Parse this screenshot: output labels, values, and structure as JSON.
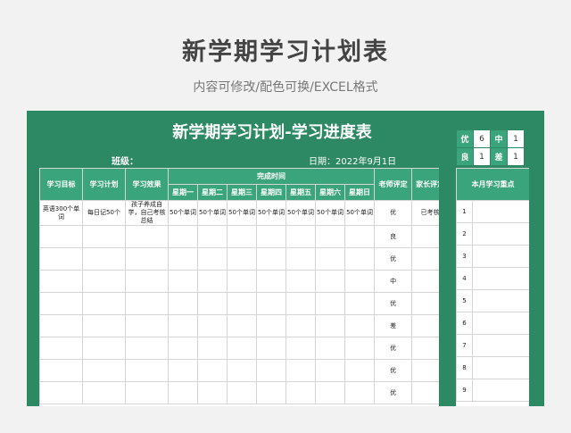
{
  "hero": {
    "title": "新学期学习计划表",
    "subtitle": "内容可修改/配色可换/EXCEL格式"
  },
  "sheet": {
    "title": "新学期学习计划-学习进度表",
    "class_label": "班级：",
    "date_label": "日期：2022年9月1日"
  },
  "grades": [
    {
      "label": "优",
      "value": "6"
    },
    {
      "label": "中",
      "value": "1"
    },
    {
      "label": "良",
      "value": "1"
    },
    {
      "label": "差",
      "value": "1"
    }
  ],
  "table": {
    "headers": {
      "goal": "学习目标",
      "plan": "学习计划",
      "effect": "学习效果",
      "completion": "完成时间",
      "teacher": "老师评定",
      "parent": "家长评定"
    },
    "weekdays": [
      "星期一",
      "星期二",
      "星期三",
      "星期四",
      "星期五",
      "星期六",
      "星期日"
    ],
    "rows": [
      {
        "goal": "英语300个单词",
        "plan": "每日记50个",
        "effect": "孩子养成自学，自己考核总结",
        "days": [
          "50个单词",
          "50个单词",
          "50个单词",
          "50个单词",
          "50个单词",
          "50个单词",
          "50个单词"
        ],
        "teacher": "优",
        "parent": "已考核"
      },
      {
        "goal": "",
        "plan": "",
        "effect": "",
        "days": [
          "",
          "",
          "",
          "",
          "",
          "",
          ""
        ],
        "teacher": "良",
        "parent": ""
      },
      {
        "goal": "",
        "plan": "",
        "effect": "",
        "days": [
          "",
          "",
          "",
          "",
          "",
          "",
          ""
        ],
        "teacher": "优",
        "parent": ""
      },
      {
        "goal": "",
        "plan": "",
        "effect": "",
        "days": [
          "",
          "",
          "",
          "",
          "",
          "",
          ""
        ],
        "teacher": "中",
        "parent": ""
      },
      {
        "goal": "",
        "plan": "",
        "effect": "",
        "days": [
          "",
          "",
          "",
          "",
          "",
          "",
          ""
        ],
        "teacher": "优",
        "parent": ""
      },
      {
        "goal": "",
        "plan": "",
        "effect": "",
        "days": [
          "",
          "",
          "",
          "",
          "",
          "",
          ""
        ],
        "teacher": "差",
        "parent": ""
      },
      {
        "goal": "",
        "plan": "",
        "effect": "",
        "days": [
          "",
          "",
          "",
          "",
          "",
          "",
          ""
        ],
        "teacher": "优",
        "parent": ""
      },
      {
        "goal": "",
        "plan": "",
        "effect": "",
        "days": [
          "",
          "",
          "",
          "",
          "",
          "",
          ""
        ],
        "teacher": "优",
        "parent": ""
      },
      {
        "goal": "",
        "plan": "",
        "effect": "",
        "days": [
          "",
          "",
          "",
          "",
          "",
          "",
          ""
        ],
        "teacher": "优",
        "parent": ""
      }
    ]
  },
  "focus": {
    "header": "本月学习重点",
    "numbers": [
      "1",
      "2",
      "3",
      "4",
      "5",
      "6",
      "7",
      "8",
      "9"
    ]
  }
}
